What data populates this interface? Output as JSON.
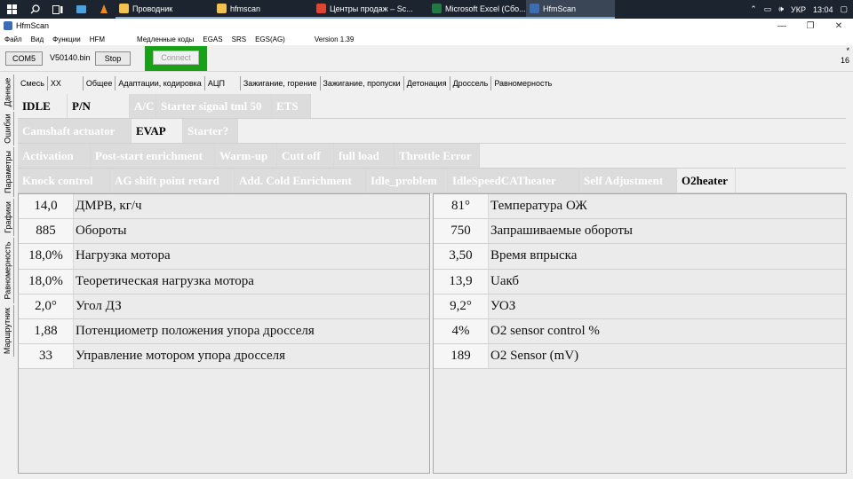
{
  "taskbar": {
    "apps": [
      {
        "label": "Проводник",
        "color": "#f2c14e"
      },
      {
        "label": "hfmscan",
        "color": "#f2c14e"
      },
      {
        "label": "Центры продаж – Sc...",
        "color": "#e14433"
      },
      {
        "label": "Microsoft Excel (Сбо...",
        "color": "#1f7a43"
      },
      {
        "label": "HfmScan",
        "color": "#3b6db4"
      }
    ],
    "lang": "УКР",
    "time": "13:04"
  },
  "window": {
    "title": "HfmScan"
  },
  "menu": {
    "items": [
      "Файл",
      "Вид",
      "Функции",
      "HFM",
      "Медленные коды",
      "EGAS",
      "SRS",
      "EGS(AG)"
    ],
    "version": "Version 1.39"
  },
  "toolbar": {
    "port": "COM5",
    "file": "V50140.bin",
    "stop": "Stop",
    "connect": "Connect",
    "corner_top": "*",
    "corner_bottom": "16"
  },
  "side_tabs": [
    "Данные",
    "Ошибки",
    "Параметры",
    "Графики",
    "Равномерность",
    "Маршрутник"
  ],
  "tabs": [
    "Смесь",
    "XX",
    "Общее",
    "Адаптации, кодировка",
    "АЦП",
    "Зажигание, горение",
    "Зажигание, пропуски",
    "Детонация",
    "Дроссель",
    "Равномерность"
  ],
  "flag_rows": [
    [
      {
        "label": "IDLE",
        "on": true
      },
      {
        "label": "P/N",
        "on": true
      },
      {
        "label": "A/C",
        "on": false
      },
      {
        "label": "Starter signal tml 50",
        "on": false
      },
      {
        "label": "ETS",
        "on": false
      }
    ],
    [
      {
        "label": "Camshaft actuator",
        "on": false
      },
      {
        "label": "EVAP",
        "on": true
      },
      {
        "label": "Starter?",
        "on": false
      }
    ],
    [
      {
        "label": "Activation",
        "on": false
      },
      {
        "label": "Post-start enrichment",
        "on": false
      },
      {
        "label": "Warm-up",
        "on": false
      },
      {
        "label": "Cutt off",
        "on": false
      },
      {
        "label": "full load",
        "on": false
      },
      {
        "label": "Throttle Error",
        "on": false
      }
    ],
    [
      {
        "label": "Knock control",
        "on": false
      },
      {
        "label": "AG shift point retard",
        "on": false
      },
      {
        "label": "Add. Cold Enrichment",
        "on": false
      },
      {
        "label": "Idle_problem",
        "on": false
      },
      {
        "label": "IdleSpeedCATheater",
        "on": false
      },
      {
        "label": "Self Adjustment",
        "on": false
      },
      {
        "label": "O2heater",
        "on": true
      }
    ]
  ],
  "left_params": [
    {
      "value": "14,0",
      "label": "ДМРВ, кг/ч"
    },
    {
      "value": "885",
      "label": "Обороты"
    },
    {
      "value": "18,0%",
      "label": "Нагрузка мотора"
    },
    {
      "value": "18,0%",
      "label": "Теоретическая нагрузка мотора"
    },
    {
      "value": "2,0°",
      "label": "Угол ДЗ"
    },
    {
      "value": "1,88",
      "label": "Потенциометр положения упора дросселя"
    },
    {
      "value": "33",
      "label": "Управление мотором упора дросселя"
    }
  ],
  "right_params": [
    {
      "value": "81°",
      "label": "Температура ОЖ"
    },
    {
      "value": "750",
      "label": "Запрашиваемые обороты"
    },
    {
      "value": "3,50",
      "label": "Время впрыска"
    },
    {
      "value": "13,9",
      "label": "Uакб"
    },
    {
      "value": "9,2°",
      "label": "УОЗ"
    },
    {
      "value": "4%",
      "label": "O2 sensor control %"
    },
    {
      "value": "189",
      "label": "O2 Sensor (mV)"
    }
  ]
}
